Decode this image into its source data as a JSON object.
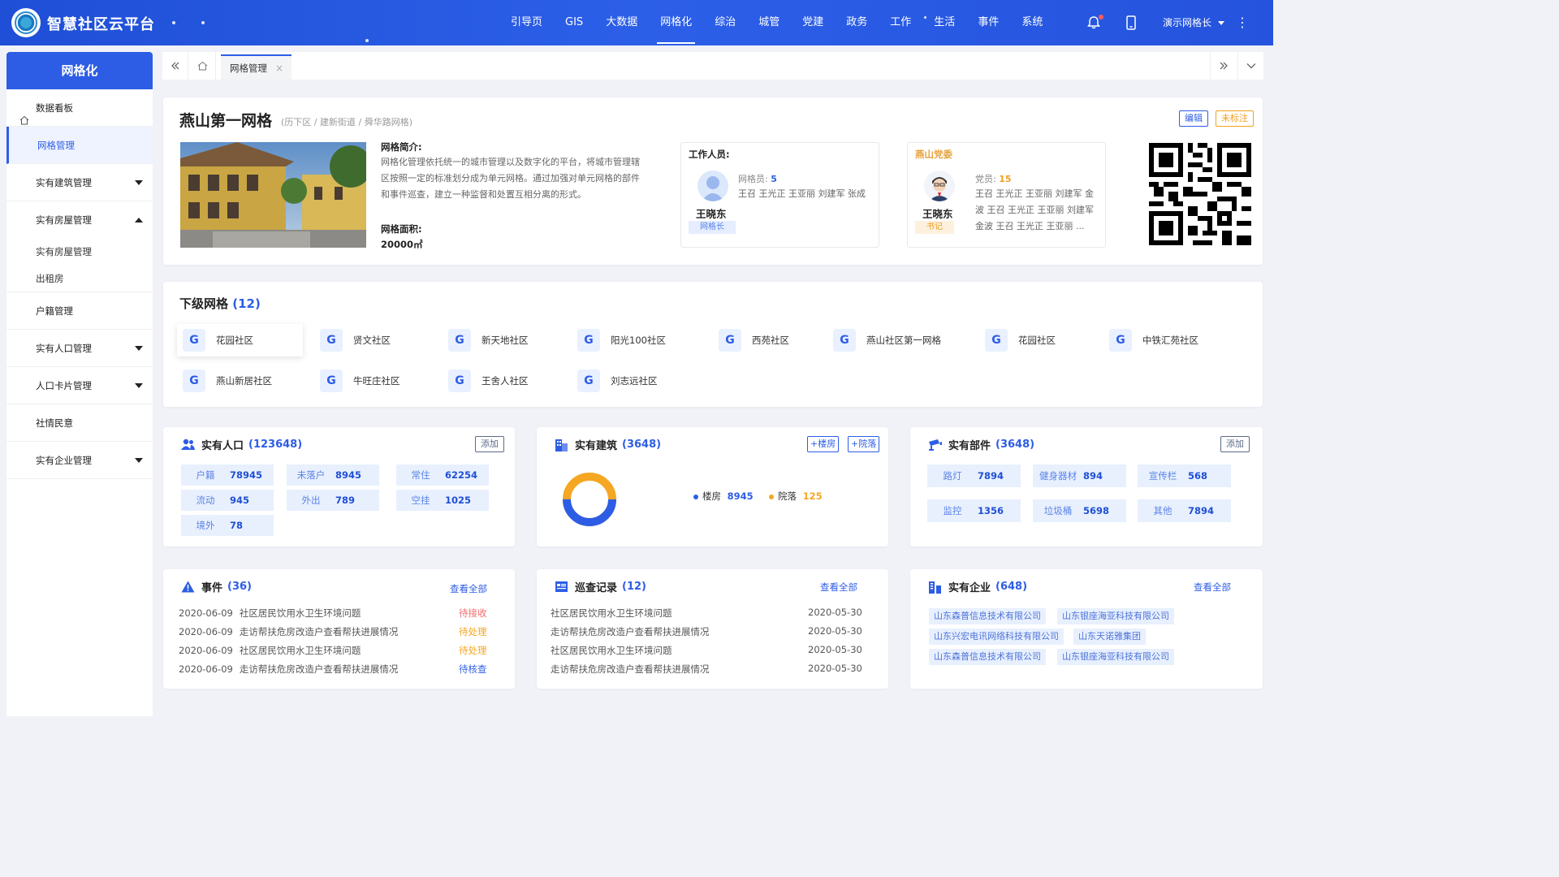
{
  "app": {
    "title": "智慧社区云平台",
    "nav": [
      "引导页",
      "GIS",
      "大数据",
      "网格化",
      "综治",
      "城管",
      "党建",
      "政务",
      "工作",
      "生活",
      "事件",
      "系统"
    ],
    "active_nav": "网格化",
    "user": "演示网格长",
    "accent": "#2d5de5"
  },
  "sidebar": {
    "title": "网格化",
    "items": [
      {
        "label": "数据看板"
      },
      {
        "label": "网格管理"
      },
      {
        "label": "实有建筑管理"
      },
      {
        "label": "实有房屋管理"
      },
      {
        "label": "实有房屋管理"
      },
      {
        "label": "出租房"
      },
      {
        "label": "户籍管理"
      },
      {
        "label": "实有人口管理"
      },
      {
        "label": "人口卡片管理"
      },
      {
        "label": "社情民意"
      },
      {
        "label": "实有企业管理"
      }
    ]
  },
  "tabs": {
    "current": "网格管理",
    "close": "×"
  },
  "grid": {
    "name": "燕山第一网格",
    "breadcrumb": "(历下区 / 建新街道 / 舜华路网格)",
    "edit": "编辑",
    "unmarked": "未标注",
    "intro_label": "网格简介:",
    "intro_lines": [
      "网格化管理依托统一的城市管理以及数字化的平台，将城市管理辖",
      "区按照一定的标准划分成为单元网格。通过加强对单元网格的部件",
      "和事件巡查，建立一种监督和处置互相分离的形式。"
    ],
    "area_label": "网格面积:",
    "area_value": "20000㎡",
    "staff": {
      "title": "工作人员:",
      "name": "王晓东",
      "role": "网格长",
      "count_label": "网格员:",
      "count": "5",
      "members": "王召 王光正 王亚丽 刘建军 张成"
    },
    "party": {
      "title": "燕山党委",
      "name": "王晓东",
      "role": "书记",
      "count_label": "党员:",
      "count": "15",
      "members": [
        "王召 王光正 王亚丽 刘建军 金",
        "波 王召 王光正 王亚丽 刘建军",
        "金波 王召 王光正 王亚丽 ..."
      ]
    }
  },
  "subgrids": {
    "title": "下级网格",
    "count": "(12)",
    "badge": "G",
    "items": [
      "花园社区",
      "贤文社区",
      "新天地社区",
      "阳光100社区",
      "西苑社区",
      "燕山社区第一网格",
      "花园社区",
      "中铁汇苑社区",
      "燕山新居社区",
      "牛旺庄社区",
      "王舍人社区",
      "刘志远社区"
    ]
  },
  "population": {
    "title": "实有人口",
    "count": "(123648)",
    "add": "添加",
    "pills": [
      {
        "k": "户籍",
        "v": "78945"
      },
      {
        "k": "未落户",
        "v": "8945"
      },
      {
        "k": "常住",
        "v": "62254"
      },
      {
        "k": "流动",
        "v": "945"
      },
      {
        "k": "外出",
        "v": "789"
      },
      {
        "k": "空挂",
        "v": "1025"
      },
      {
        "k": "境外",
        "v": "78"
      }
    ]
  },
  "buildings": {
    "title": "实有建筑",
    "count": "(3648)",
    "add_building": "+楼房",
    "add_yard": "+院落",
    "chart_data": {
      "type": "pie",
      "categories": [
        "楼房",
        "院落"
      ],
      "values": [
        8945,
        125
      ],
      "colors": [
        "#2d5de5",
        "#f5a623"
      ]
    }
  },
  "components": {
    "title": "实有部件",
    "count": "(3648)",
    "add": "添加",
    "pills": [
      {
        "k": "路灯",
        "v": "7894"
      },
      {
        "k": "健身器材",
        "v": "894"
      },
      {
        "k": "宣传栏",
        "v": "568"
      },
      {
        "k": "监控",
        "v": "1356"
      },
      {
        "k": "垃圾桶",
        "v": "5698"
      },
      {
        "k": "其他",
        "v": "7894"
      }
    ]
  },
  "events": {
    "title": "事件",
    "count": "(36)",
    "more": "查看全部",
    "rows": [
      {
        "date": "2020-06-09",
        "text": "社区居民饮用水卫生环境问题",
        "status": "待接收",
        "color": "#f56c6c"
      },
      {
        "date": "2020-06-09",
        "text": "走访帮扶危房改造户查看帮扶进展情况",
        "status": "待处理",
        "color": "#f5a623"
      },
      {
        "date": "2020-06-09",
        "text": "社区居民饮用水卫生环境问题",
        "status": "待处理",
        "color": "#f5a623"
      },
      {
        "date": "2020-06-09",
        "text": "走访帮扶危房改造户查看帮扶进展情况",
        "status": "待核查",
        "color": "#2d5de5"
      }
    ]
  },
  "patrol": {
    "title": "巡查记录",
    "count": "(12)",
    "more": "查看全部",
    "rows": [
      {
        "text": "社区居民饮用水卫生环境问题",
        "date": "2020-05-30"
      },
      {
        "text": "走访帮扶危房改造户查看帮扶进展情况",
        "date": "2020-05-30"
      },
      {
        "text": "社区居民饮用水卫生环境问题",
        "date": "2020-05-30"
      },
      {
        "text": "走访帮扶危房改造户查看帮扶进展情况",
        "date": "2020-05-30"
      }
    ]
  },
  "enterprises": {
    "title": "实有企业",
    "count": "(648)",
    "more": "查看全部",
    "tags": [
      "山东森普信息技术有限公司",
      "山东银座海亚科技有限公司",
      "山东兴宏电讯网络科技有限公司",
      "山东天诺雅集团",
      "山东森普信息技术有限公司",
      "山东银座海亚科技有限公司"
    ]
  }
}
